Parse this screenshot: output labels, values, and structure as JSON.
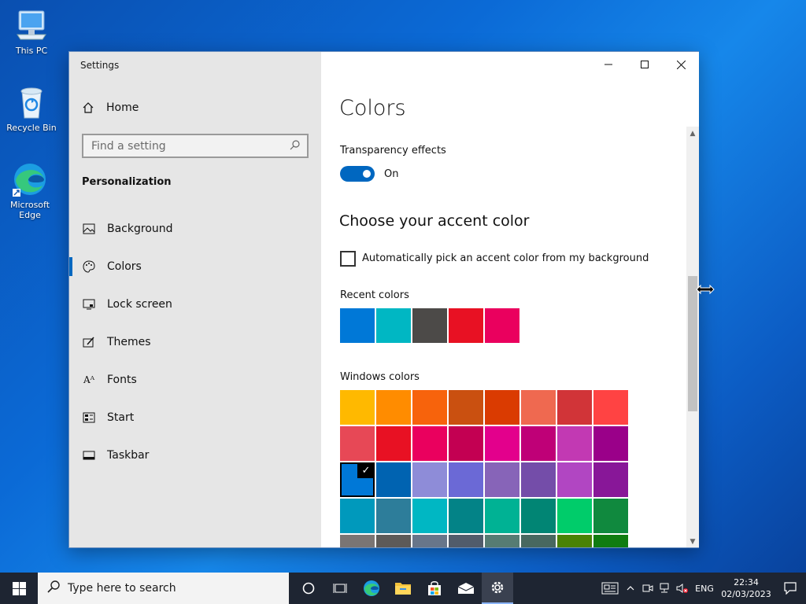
{
  "desktop": {
    "icons": [
      {
        "label": "This PC",
        "icon": "computer-icon"
      },
      {
        "label": "Recycle Bin",
        "icon": "recycle-bin-icon"
      },
      {
        "label": "Microsoft Edge",
        "icon": "edge-icon"
      }
    ]
  },
  "window": {
    "title": "Settings",
    "sidebar": {
      "home_label": "Home",
      "search_placeholder": "Find a setting",
      "section_title": "Personalization",
      "items": [
        {
          "label": "Background",
          "icon": "background-image-icon",
          "active": false
        },
        {
          "label": "Colors",
          "icon": "palette-icon",
          "active": true
        },
        {
          "label": "Lock screen",
          "icon": "lock-screen-icon",
          "active": false
        },
        {
          "label": "Themes",
          "icon": "themes-icon",
          "active": false
        },
        {
          "label": "Fonts",
          "icon": "fonts-icon",
          "active": false
        },
        {
          "label": "Start",
          "icon": "start-icon",
          "active": false
        },
        {
          "label": "Taskbar",
          "icon": "taskbar-icon",
          "active": false
        }
      ]
    },
    "content": {
      "page_title": "Colors",
      "transparency_label": "Transparency effects",
      "transparency_state": "On",
      "accent_heading": "Choose your accent color",
      "auto_pick_label": "Automatically pick an accent color from my background",
      "auto_pick_checked": false,
      "recent_colors_label": "Recent colors",
      "recent_colors": [
        "#0078d7",
        "#00b7c3",
        "#4c4a48",
        "#e81123",
        "#ea005e"
      ],
      "windows_colors_label": "Windows colors",
      "windows_colors": [
        [
          "#ffb900",
          "#ff8c00",
          "#f7630c",
          "#ca5010",
          "#da3b01",
          "#ef6950",
          "#d13438",
          "#ff4343"
        ],
        [
          "#e74856",
          "#e81123",
          "#ea005e",
          "#c30052",
          "#e3008c",
          "#bf0077",
          "#c239b3",
          "#9a0089"
        ],
        [
          "#0078d7",
          "#0063b1",
          "#8e8cd8",
          "#6b69d6",
          "#8764b8",
          "#744da9",
          "#b146c2",
          "#881798"
        ],
        [
          "#0099bc",
          "#2d7d9a",
          "#00b7c3",
          "#038387",
          "#00b294",
          "#018574",
          "#00cc6a",
          "#10893e"
        ],
        [
          "#7a7574",
          "#5d5a58",
          "#68768a",
          "#515c6b",
          "#567c73",
          "#486860",
          "#498205",
          "#107c10"
        ]
      ],
      "selected_color": "#0078d7"
    }
  },
  "taskbar": {
    "search_placeholder": "Type here to search",
    "apps": [
      {
        "name": "cortana-icon"
      },
      {
        "name": "task-view-icon"
      },
      {
        "name": "edge-icon"
      },
      {
        "name": "file-explorer-icon"
      },
      {
        "name": "store-icon"
      },
      {
        "name": "mail-icon"
      },
      {
        "name": "settings-icon",
        "active": true
      }
    ],
    "tray": {
      "language": "ENG",
      "time": "22:34",
      "date": "02/03/2023"
    }
  }
}
